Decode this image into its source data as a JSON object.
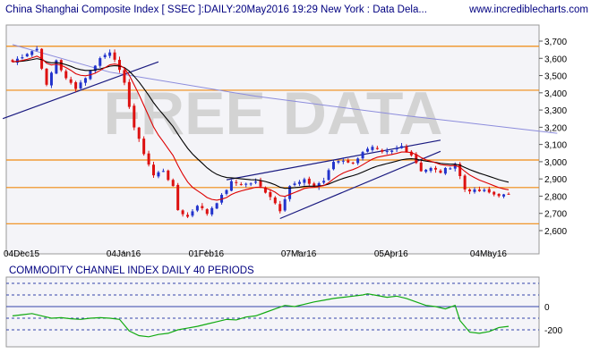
{
  "header": {
    "title": "China Shanghai Composite Index [ SSEC ]:DAILY:20May2016 19:29 New York : Data Dela...",
    "site": "www.incrediblecharts.com"
  },
  "watermark": "FREE DATA",
  "colors": {
    "background": "#ffffff",
    "panel_fill": "#f4f4f8",
    "up_candle": "#2233cc",
    "down_candle": "#dd1111",
    "ema_fast": "#dd0000",
    "ema_slow": "#000000",
    "long_trend": "#8c8cdc",
    "horizontal_levels": "#f08a10",
    "trendlines": "#1a1a80",
    "cci_line": "#11aa11",
    "cci_guide": "#3344aa",
    "watermark": "#d3d3d3"
  },
  "chart_data": [
    {
      "type": "candlestick",
      "title": "China Shanghai Composite Index [ SSEC ]:DAILY:20May2016 19:29 New York : Data Dela...",
      "x_labels": [
        "04Dec15",
        "04Jan16",
        "01Feb16",
        "07Mar16",
        "05Apr16",
        "04May16"
      ],
      "x_label_bar_index": [
        0,
        21,
        38,
        57,
        76,
        96
      ],
      "y_ticks": [
        "3,700",
        "3,600",
        "3,500",
        "3,400",
        "3,300",
        "3,200",
        "3,100",
        "3,000",
        "2,900",
        "2,800",
        "2,700",
        "2,600"
      ],
      "ylim": [
        2560,
        3760
      ],
      "grid": false,
      "horizontal_levels": [
        3670,
        3415,
        3010,
        2850,
        2640
      ],
      "long_trend_line": [
        {
          "x": 0,
          "y": 3680
        },
        {
          "x": 20,
          "y": 3520
        },
        {
          "x": 50,
          "y": 3380
        },
        {
          "x": 80,
          "y": 3270
        },
        {
          "x": 112,
          "y": 3165
        }
      ],
      "trendlines": [
        [
          {
            "x": -2,
            "y": 3250
          },
          {
            "x": 30,
            "y": 3580
          }
        ],
        [
          {
            "x": 44,
            "y": 2895
          },
          {
            "x": 88,
            "y": 3125
          }
        ],
        [
          {
            "x": 55,
            "y": 2670
          },
          {
            "x": 88,
            "y": 3060
          }
        ]
      ],
      "anchors": [
        [
          0,
          3580
        ],
        [
          3,
          3630
        ],
        [
          5,
          3655
        ],
        [
          7,
          3440
        ],
        [
          9,
          3590
        ],
        [
          11,
          3480
        ],
        [
          13,
          3430
        ],
        [
          15,
          3490
        ],
        [
          18,
          3600
        ],
        [
          20,
          3640
        ],
        [
          21,
          3600
        ],
        [
          23,
          3450
        ],
        [
          25,
          3200
        ],
        [
          27,
          3050
        ],
        [
          29,
          2920
        ],
        [
          31,
          2950
        ],
        [
          33,
          2850
        ],
        [
          34,
          2720
        ],
        [
          36,
          2680
        ],
        [
          38,
          2750
        ],
        [
          40,
          2700
        ],
        [
          43,
          2800
        ],
        [
          45,
          2880
        ],
        [
          48,
          2870
        ],
        [
          50,
          2880
        ],
        [
          53,
          2800
        ],
        [
          55,
          2720
        ],
        [
          57,
          2860
        ],
        [
          60,
          2890
        ],
        [
          62,
          2860
        ],
        [
          64,
          2890
        ],
        [
          66,
          3000
        ],
        [
          68,
          3010
        ],
        [
          70,
          2990
        ],
        [
          72,
          3060
        ],
        [
          74,
          3080
        ],
        [
          76,
          3050
        ],
        [
          78,
          3060
        ],
        [
          80,
          3090
        ],
        [
          82,
          3040
        ],
        [
          84,
          2950
        ],
        [
          86,
          2960
        ],
        [
          88,
          2940
        ],
        [
          90,
          2970
        ],
        [
          91,
          2990
        ],
        [
          93,
          2840
        ],
        [
          95,
          2830
        ],
        [
          97,
          2830
        ],
        [
          99,
          2810
        ],
        [
          101,
          2805
        ]
      ],
      "ema_fast_period": 10,
      "ema_slow_period": 21
    },
    {
      "type": "line",
      "title": "COMMODITY CHANNEL INDEX DAILY 40 PERIODS",
      "y_ticks": [
        "0",
        "-200"
      ],
      "ylim": [
        -300,
        300
      ],
      "reference_levels": [
        200,
        100,
        0,
        -100,
        -200
      ],
      "series": [
        {
          "values": [
            [
              0,
              -80
            ],
            [
              2,
              -70
            ],
            [
              4,
              -60
            ],
            [
              6,
              -80
            ],
            [
              8,
              -100
            ],
            [
              10,
              -95
            ],
            [
              12,
              -105
            ],
            [
              14,
              -110
            ],
            [
              16,
              -100
            ],
            [
              18,
              -95
            ],
            [
              20,
              -100
            ],
            [
              22,
              -110
            ],
            [
              23,
              -160
            ],
            [
              24,
              -210
            ],
            [
              26,
              -250
            ],
            [
              28,
              -260
            ],
            [
              30,
              -240
            ],
            [
              32,
              -230
            ],
            [
              34,
              -200
            ],
            [
              36,
              -185
            ],
            [
              38,
              -170
            ],
            [
              40,
              -150
            ],
            [
              42,
              -130
            ],
            [
              44,
              -110
            ],
            [
              46,
              -115
            ],
            [
              48,
              -90
            ],
            [
              50,
              -80
            ],
            [
              52,
              -50
            ],
            [
              54,
              -20
            ],
            [
              56,
              10
            ],
            [
              58,
              0
            ],
            [
              60,
              20
            ],
            [
              62,
              40
            ],
            [
              64,
              55
            ],
            [
              66,
              70
            ],
            [
              68,
              80
            ],
            [
              70,
              90
            ],
            [
              72,
              100
            ],
            [
              73,
              110
            ],
            [
              75,
              95
            ],
            [
              77,
              80
            ],
            [
              79,
              90
            ],
            [
              81,
              70
            ],
            [
              83,
              40
            ],
            [
              85,
              10
            ],
            [
              87,
              0
            ],
            [
              89,
              -20
            ],
            [
              91,
              10
            ],
            [
              92,
              -120
            ],
            [
              94,
              -220
            ],
            [
              96,
              -230
            ],
            [
              98,
              -215
            ],
            [
              100,
              -180
            ],
            [
              102,
              -170
            ]
          ]
        }
      ]
    }
  ]
}
